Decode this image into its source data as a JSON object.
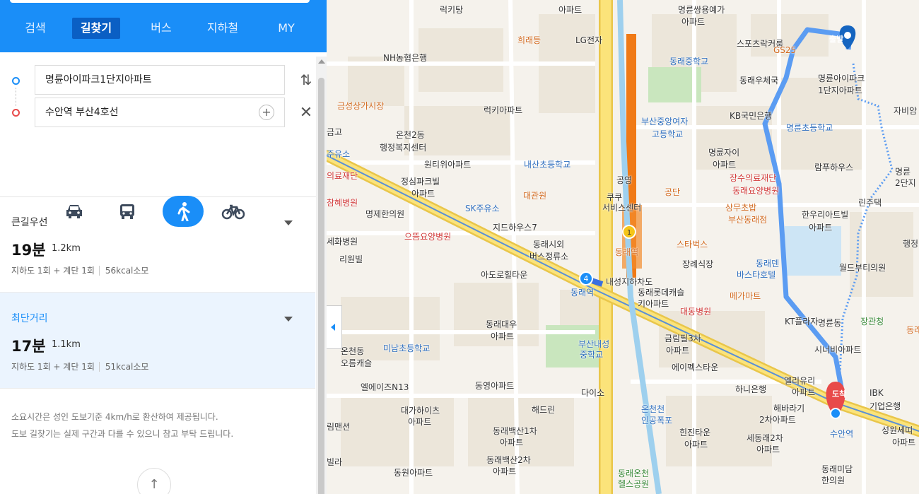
{
  "nav": {
    "tabs": [
      {
        "label": "검색"
      },
      {
        "label": "길찾기"
      },
      {
        "label": "버스"
      },
      {
        "label": "지하철"
      },
      {
        "label": "MY"
      }
    ],
    "active_tab": "길찾기"
  },
  "route_form": {
    "origin": "명륜아이파크1단지아파트",
    "destination": "수안역 부산4호선",
    "add_waypoint": "+",
    "modes": [
      {
        "name": "car",
        "icon": "car-icon"
      },
      {
        "name": "transit",
        "icon": "bus-icon"
      },
      {
        "name": "walk",
        "icon": "walking-icon"
      },
      {
        "name": "bike",
        "icon": "bicycle-icon"
      }
    ],
    "active_mode": "walk"
  },
  "routes": [
    {
      "title": "큰길우선",
      "time": "19분",
      "distance": "1.2km",
      "detail": "지하도 1회 + 계단 1회",
      "kcal": "56kcal소모"
    },
    {
      "title": "최단거리",
      "time": "17분",
      "distance": "1.1km",
      "detail": "지하도 1회 + 계단 1회",
      "kcal": "51kcal소모"
    }
  ],
  "notes": {
    "line1": "소요시간은 성인 도보기준 4km/h로 환산하여 제공됩니다.",
    "line2": "도보 길찾기는 실제 구간과 다를 수 있으니 참고 부탁 드립니다."
  },
  "map": {
    "markers": {
      "start": "출발",
      "end": "도착"
    },
    "labels": [
      {
        "text": "럭키탕",
        "cls": ""
      },
      {
        "text": "아파트",
        "cls": ""
      },
      {
        "text": "명륜쌍용예가",
        "cls": ""
      },
      {
        "text": "아파트",
        "cls": ""
      },
      {
        "text": "희래등",
        "cls": "orange"
      },
      {
        "text": "LG전자",
        "cls": ""
      },
      {
        "text": "스포츠락커룸",
        "cls": ""
      },
      {
        "text": "GS25",
        "cls": "orange"
      },
      {
        "text": "NH농협은행",
        "cls": ""
      },
      {
        "text": "동래중학교",
        "cls": "blue"
      },
      {
        "text": "동래우체국",
        "cls": ""
      },
      {
        "text": "명륜아이파크",
        "cls": ""
      },
      {
        "text": "1단지아파트",
        "cls": ""
      },
      {
        "text": "금성상가시장",
        "cls": "orange"
      },
      {
        "text": "럭키아파트",
        "cls": ""
      },
      {
        "text": "부산중앙여자",
        "cls": "blue"
      },
      {
        "text": "고등학교",
        "cls": "blue"
      },
      {
        "text": "KB국민은행",
        "cls": ""
      },
      {
        "text": "명륜초등학교",
        "cls": "blue"
      },
      {
        "text": "자비암",
        "cls": ""
      },
      {
        "text": "온천2동",
        "cls": ""
      },
      {
        "text": "행정복지센터",
        "cls": ""
      },
      {
        "text": "명륜자이",
        "cls": ""
      },
      {
        "text": "아파트",
        "cls": ""
      },
      {
        "text": "람푸하우스",
        "cls": ""
      },
      {
        "text": "원티위아파트",
        "cls": ""
      },
      {
        "text": "내산초등학교",
        "cls": "blue"
      },
      {
        "text": "공영",
        "cls": ""
      },
      {
        "text": "장수의료재단",
        "cls": "red"
      },
      {
        "text": "동래요양병원",
        "cls": "red"
      },
      {
        "text": "명륜",
        "cls": ""
      },
      {
        "text": "2단지",
        "cls": ""
      },
      {
        "text": "정심파크빌",
        "cls": ""
      },
      {
        "text": "아파트",
        "cls": ""
      },
      {
        "text": "대관원",
        "cls": "orange"
      },
      {
        "text": "쿠쿠",
        "cls": ""
      },
      {
        "text": "서비스센터",
        "cls": ""
      },
      {
        "text": "공단",
        "cls": "orange"
      },
      {
        "text": "상무초밥",
        "cls": "orange"
      },
      {
        "text": "부산동래점",
        "cls": "orange"
      },
      {
        "text": "한우리아트빌",
        "cls": ""
      },
      {
        "text": "아파트",
        "cls": ""
      },
      {
        "text": "린주택",
        "cls": ""
      },
      {
        "text": "주유소",
        "cls": "blue"
      },
      {
        "text": "의료재단",
        "cls": "red"
      },
      {
        "text": "참혜병원",
        "cls": "red"
      },
      {
        "text": "SK주유소",
        "cls": "blue"
      },
      {
        "text": "명제한의원",
        "cls": ""
      },
      {
        "text": "지드하우스7",
        "cls": ""
      },
      {
        "text": "으뜸요양병원",
        "cls": "red"
      },
      {
        "text": "세화병원",
        "cls": ""
      },
      {
        "text": "동래시외",
        "cls": ""
      },
      {
        "text": "버스정류소",
        "cls": ""
      },
      {
        "text": "스타벅스",
        "cls": "orange"
      },
      {
        "text": "행정",
        "cls": ""
      },
      {
        "text": "리원빌",
        "cls": ""
      },
      {
        "text": "장례식장",
        "cls": ""
      },
      {
        "text": "동래덴",
        "cls": "blue"
      },
      {
        "text": "바스타호텔",
        "cls": "blue"
      },
      {
        "text": "월드부티의원",
        "cls": ""
      },
      {
        "text": "아도로힐타운",
        "cls": ""
      },
      {
        "text": "동래역",
        "cls": "blue"
      },
      {
        "text": "동래롯데캐슬",
        "cls": ""
      },
      {
        "text": "키아파트",
        "cls": ""
      },
      {
        "text": "메가마트",
        "cls": "orange"
      },
      {
        "text": "대동병원",
        "cls": "red"
      },
      {
        "text": "KT플라자",
        "cls": ""
      },
      {
        "text": "장관청",
        "cls": "green"
      },
      {
        "text": "동래대우",
        "cls": ""
      },
      {
        "text": "아파트",
        "cls": ""
      },
      {
        "text": "부산내성",
        "cls": "blue"
      },
      {
        "text": "중학교",
        "cls": "blue"
      },
      {
        "text": "명륜동",
        "cls": ""
      },
      {
        "text": "시너비아파트",
        "cls": ""
      },
      {
        "text": "동래",
        "cls": "orange"
      },
      {
        "text": "금림필3차",
        "cls": ""
      },
      {
        "text": "아파트",
        "cls": ""
      },
      {
        "text": "온천동",
        "cls": ""
      },
      {
        "text": "오름캐슬",
        "cls": ""
      },
      {
        "text": "미남초등학교",
        "cls": "blue"
      },
      {
        "text": "에이펙스타운",
        "cls": ""
      },
      {
        "text": "엘리유리",
        "cls": ""
      },
      {
        "text": "아파트",
        "cls": ""
      },
      {
        "text": "하니은행",
        "cls": ""
      },
      {
        "text": "IBK",
        "cls": ""
      },
      {
        "text": "기업은행",
        "cls": ""
      },
      {
        "text": "엘에이즈N13",
        "cls": ""
      },
      {
        "text": "동영아파트",
        "cls": ""
      },
      {
        "text": "다이소",
        "cls": ""
      },
      {
        "text": "대가하이츠",
        "cls": ""
      },
      {
        "text": "아파트",
        "cls": ""
      },
      {
        "text": "해드린",
        "cls": ""
      },
      {
        "text": "온천천",
        "cls": "blue"
      },
      {
        "text": "인공폭포",
        "cls": "blue"
      },
      {
        "text": "해바라기",
        "cls": ""
      },
      {
        "text": "2차아파트",
        "cls": ""
      },
      {
        "text": "수안역",
        "cls": "blue"
      },
      {
        "text": "성원세띠",
        "cls": ""
      },
      {
        "text": "아파트",
        "cls": ""
      },
      {
        "text": "림맨션",
        "cls": ""
      },
      {
        "text": "동래백산1차",
        "cls": ""
      },
      {
        "text": "아파트",
        "cls": ""
      },
      {
        "text": "힌진타운",
        "cls": ""
      },
      {
        "text": "아파트",
        "cls": ""
      },
      {
        "text": "세동래2차",
        "cls": ""
      },
      {
        "text": "아파트",
        "cls": ""
      },
      {
        "text": "동래백산2차",
        "cls": ""
      },
      {
        "text": "아파트",
        "cls": ""
      },
      {
        "text": "동래미담",
        "cls": ""
      },
      {
        "text": "한의원",
        "cls": ""
      },
      {
        "text": "빌라",
        "cls": ""
      },
      {
        "text": "동원아파트",
        "cls": ""
      },
      {
        "text": "동래온천",
        "cls": "green"
      },
      {
        "text": "헬스공원",
        "cls": "green"
      },
      {
        "text": "금고",
        "cls": ""
      },
      {
        "text": "동래역",
        "cls": "orange"
      },
      {
        "text": "내성지하차도",
        "cls": ""
      }
    ]
  },
  "colors": {
    "primary": "#1a8ef8",
    "route": "#5b9cf2",
    "start_marker": "#1565c0",
    "end_marker": "#e84a4a",
    "subway_orange": "#f07a16"
  }
}
